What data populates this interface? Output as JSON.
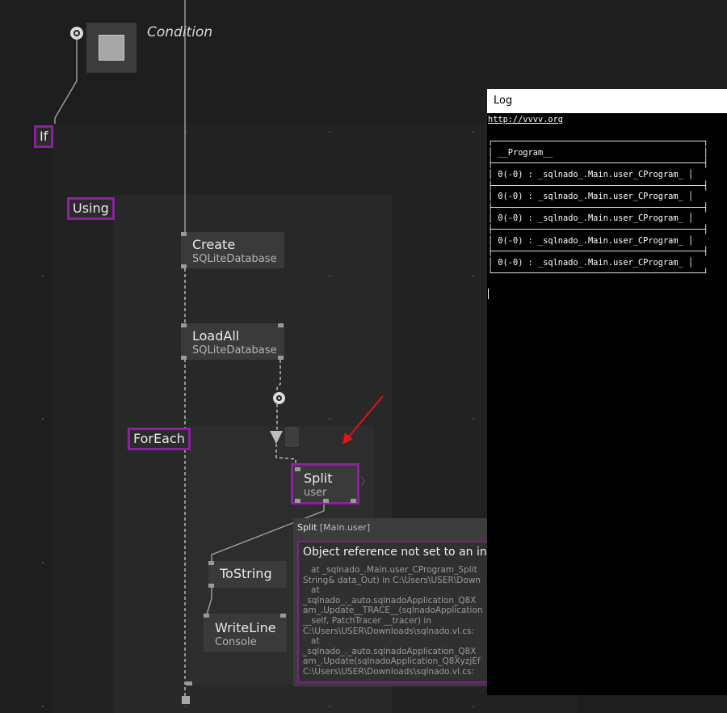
{
  "condition": {
    "label": "Condition"
  },
  "regions": {
    "if": "If",
    "using": "Using",
    "foreach": "ForEach"
  },
  "nodes": {
    "create": {
      "title": "Create",
      "subtitle": "SQLiteDatabase"
    },
    "loadall": {
      "title": "LoadAll",
      "subtitle": "SQLiteDatabase"
    },
    "split": {
      "title": "Split",
      "subtitle": "user"
    },
    "tostring": {
      "title": "ToString"
    },
    "writeline": {
      "title": "WriteLine",
      "subtitle": "Console"
    }
  },
  "log": {
    "title": "Log",
    "link": "http://vvvv.org",
    "lines": [
      "",
      "┌──────────────────────────────────────────┐",
      "│ __Program__                              │",
      "├──────────────────────────────────────────┤",
      "│ 0(-0) : _sqlnado_.Main.user_CProgram_ │",
      "├──────────────────────────────────────────┤",
      "│ 0(-0) : _sqlnado_.Main.user_CProgram_ │",
      "├──────────────────────────────────────────┤",
      "│ 0(-0) : _sqlnado_.Main.user_CProgram_ │",
      "├──────────────────────────────────────────┤",
      "│ 0(-0) : _sqlnado_.Main.user_CProgram_ │",
      "├──────────────────────────────────────────┤",
      "│ 0(-0) : _sqlnado_.Main.user_CProgram_ │",
      "└──────────────────────────────────────────┘"
    ]
  },
  "tooltip": {
    "node": "Split",
    "type": "[Main.user]",
    "message": "Object reference not set to an ins",
    "trace": [
      "   at _sqlnado_.Main.user_CProgram_Split",
      "String& data_Out) in C:\\Users\\USER\\Down",
      "   at",
      "_sqlnado_._auto.sqlnadoApplication_Q8X",
      "am_.Update__TRACE__(sqlnadoApplication",
      "__self, PatchTracer __tracer) in",
      "C:\\Users\\USER\\Downloads\\sqlnado.vl.cs:",
      "   at",
      "_sqlnado_._auto.sqlnadoApplication_Q8X",
      "am_.Update(sqlnadoApplication_Q8XyzjEf",
      "C:\\Users\\USER\\Downloads\\sqlnado.vl.cs:"
    ]
  },
  "colors": {
    "canvas": "#1e1e1e",
    "region_highlight": "#8e1fa3",
    "node_fill": "#3a3a3a",
    "annotation_arrow": "#e01515"
  }
}
